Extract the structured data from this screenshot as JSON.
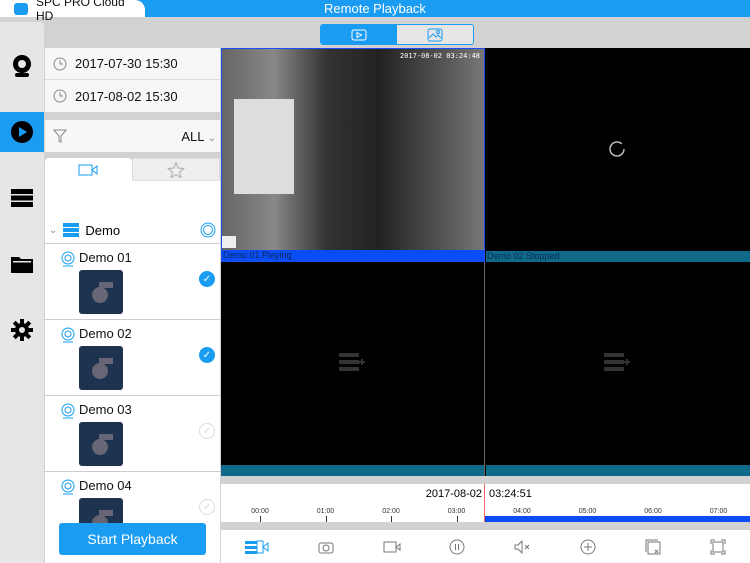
{
  "app": {
    "name": "SPC PRO Cloud HD",
    "logo_text": "SPC",
    "title": "Remote Playback"
  },
  "nav": [
    {
      "icon": "camera-icon"
    },
    {
      "icon": "playback-icon",
      "active": true
    },
    {
      "icon": "server-icon"
    },
    {
      "icon": "folder-icon"
    },
    {
      "icon": "gear-icon"
    }
  ],
  "filters": {
    "start_time": "2017-07-30 15:30",
    "end_time": "2017-08-02 15:30",
    "filter_value": "ALL"
  },
  "device": {
    "name": "Demo"
  },
  "cameras": [
    {
      "name": "Demo 01",
      "checked": true
    },
    {
      "name": "Demo 02",
      "checked": true
    },
    {
      "name": "Demo 03",
      "checked": false
    },
    {
      "name": "Demo 04",
      "checked": false
    }
  ],
  "start_button": "Start Playback",
  "views": [
    {
      "label": "Demo 01  Playing",
      "timestamp": "2017-08-02 03:24:48"
    },
    {
      "label": "Demo 02  Stopped"
    },
    {
      "label": ""
    },
    {
      "label": ""
    }
  ],
  "timeline": {
    "date": "2017-08-02",
    "time": "03:24:51",
    "ticks": [
      "00:00",
      "01:00",
      "02:00",
      "03:00",
      "04:00",
      "05:00",
      "06:00",
      "07:00"
    ],
    "recorded_from_hour": 3.42
  },
  "colors": {
    "accent": "#1a9cf2",
    "playing": "#0a4cf5",
    "stopped": "#0f6a8a"
  }
}
